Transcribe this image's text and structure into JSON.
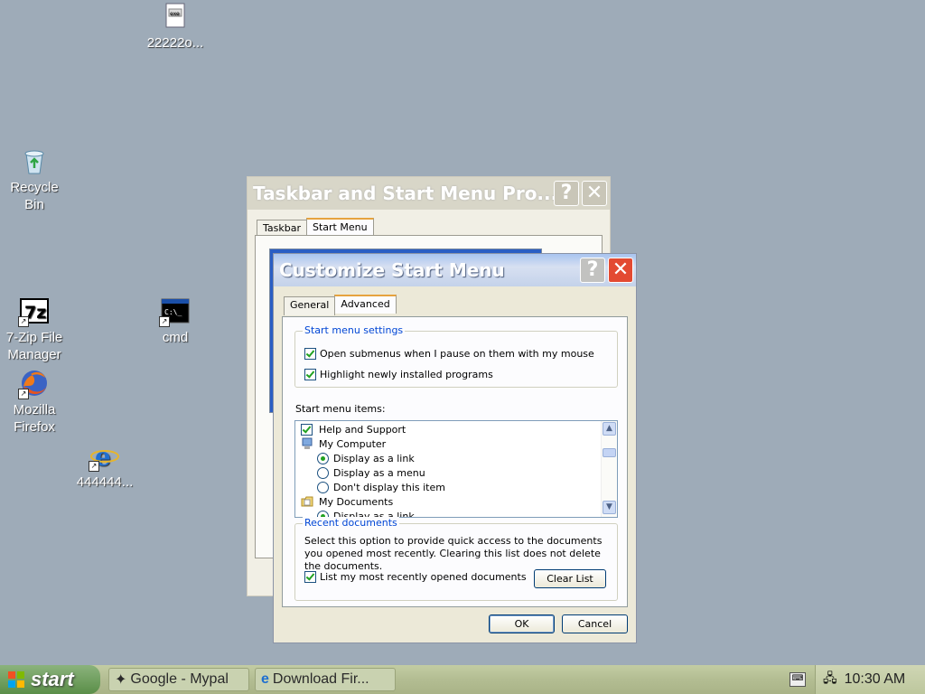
{
  "desktop": {
    "icons": [
      {
        "label": "22222o..."
      },
      {
        "label": "Recycle Bin"
      },
      {
        "label": "7-Zip File Manager"
      },
      {
        "label": "cmd"
      },
      {
        "label": "Mozilla Firefox"
      },
      {
        "label": "444444..."
      }
    ]
  },
  "bg_window": {
    "title": "Taskbar and Start Menu Pro...",
    "tabs": [
      "Taskbar",
      "Start Menu"
    ],
    "active_tab": "Start Menu"
  },
  "dialog": {
    "title": "Customize Start Menu",
    "help_label": "?",
    "close_label": "X",
    "tabs": [
      "General",
      "Advanced"
    ],
    "active_tab": "Advanced",
    "settings_group": {
      "legend": "Start menu settings",
      "options": [
        {
          "label": "Open submenus when I pause on them with my mouse",
          "checked": true
        },
        {
          "label": "Highlight newly installed programs",
          "checked": true
        }
      ]
    },
    "items_label": "Start menu items:",
    "items": [
      {
        "label": "Help and Support",
        "kind": "checkbox",
        "checked": true
      },
      {
        "label": "My Computer",
        "kind": "folder"
      },
      {
        "label": "Display as a link",
        "kind": "radio",
        "selected": true
      },
      {
        "label": "Display as a menu",
        "kind": "radio",
        "selected": false
      },
      {
        "label": "Don't display this item",
        "kind": "radio",
        "selected": false
      },
      {
        "label": "My Documents",
        "kind": "folder"
      },
      {
        "label": "Display as a link",
        "kind": "radio",
        "selected": true
      }
    ],
    "recent_group": {
      "legend": "Recent documents",
      "description": "Select this option to provide quick access to the documents you opened most recently.  Clearing this list does not delete the documents.",
      "checkbox_label": "List my most recently opened documents",
      "checked": true,
      "clear_button": "Clear List"
    },
    "ok_button": "OK",
    "cancel_button": "Cancel"
  },
  "taskbar": {
    "start_label": "start",
    "tasks": [
      {
        "label": "Google - Mypal"
      },
      {
        "label": "Download Fir..."
      }
    ],
    "clock": "10:30 AM"
  }
}
